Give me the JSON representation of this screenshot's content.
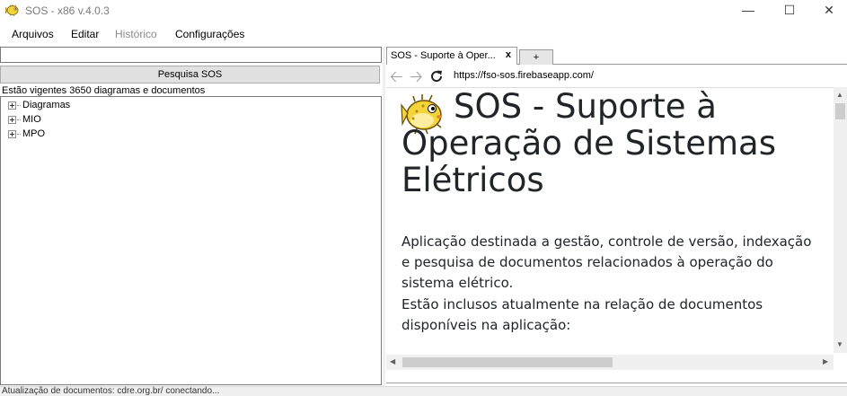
{
  "window": {
    "title": "SOS - x86 v.4.0.3",
    "app_icon": "pufferfish-icon",
    "controls": {
      "minimize": "—",
      "maximize": "☐",
      "close": "✕"
    }
  },
  "menu": {
    "items": [
      {
        "label": "Arquivos",
        "enabled": true
      },
      {
        "label": "Editar",
        "enabled": true
      },
      {
        "label": "Histórico",
        "enabled": false
      },
      {
        "label": "Configurações",
        "enabled": true
      }
    ]
  },
  "left_panel": {
    "search_value": "",
    "search_button": "Pesquisa SOS",
    "summary": "Estão vigentes 3650 diagramas e documentos",
    "tree": [
      {
        "label": "Diagramas"
      },
      {
        "label": "MIO"
      },
      {
        "label": "MPO"
      }
    ]
  },
  "browser": {
    "tabs": [
      {
        "label": "SOS - Suporte à Oper...",
        "close": "x",
        "active": true
      }
    ],
    "new_tab_label": "+",
    "nav": {
      "back": "back-arrow-icon",
      "forward": "forward-arrow-icon",
      "reload": "reload-icon"
    },
    "url": "https://fso-sos.firebaseapp.com/",
    "page": {
      "heading": "SOS - Suporte à Operação de Sistemas Elétricos",
      "paragraph1": "Aplicação destinada a gestão, controle de versão, indexação e pesquisa de documentos relacionados à operação do sistema elétrico.",
      "paragraph2": "Estão inclusos atualmente na relação de documentos disponíveis na aplicação:"
    }
  },
  "statusbar": {
    "text": "Atualização de documentos: cdre.org.br/ conectando..."
  },
  "colors": {
    "heading_text": "#212529",
    "button_face": "#e1e1e1",
    "disabled_text": "#8a8a8a"
  }
}
